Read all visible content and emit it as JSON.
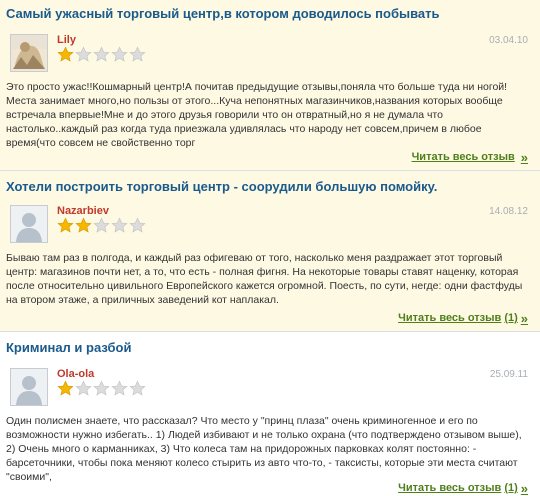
{
  "reviews": [
    {
      "title": "Самый ужасный торговый центр,в котором доводилось побывать",
      "author": "Lily",
      "date": "03.04.10",
      "rating": 1,
      "max_rating": 5,
      "text_lines": [
        "Это просто ужас!!Кошмарный центр!А почитав предыдущие отзывы,поняла что больше туда ни ногой!",
        "Места занимает много,но пользы от этого...Куча непонятных магазинчиков,названия которых вообще",
        "встречала впервые!Мне и до этого друзья говорили что он отвратный,но я не думала что",
        "настолько..каждый раз когда туда приезжала удивлялась что народу нет совсем,причем в любое",
        "время(что совсем не свойственно торг"
      ],
      "read_more": "Читать весь отзыв",
      "read_more_count": ""
    },
    {
      "title": "Хотели построить торговый центр - соорудили большую помойку.",
      "author": "Nazarbiev",
      "date": "14.08.12",
      "rating": 2,
      "max_rating": 5,
      "text_lines": [
        "Бываю там раз в полгода, и каждый раз офигеваю от того, насколько меня раздражает этот торговый",
        "центр: магазинов почти нет, а то, что есть - полная фигня. На некоторые товары ставят наценку, которая",
        "после относительно цивильного Европейского кажется огромной. Поесть, по сути, негде: одни фастфуды",
        "на втором этаже, а приличных заведений кот наплакал."
      ],
      "read_more": "Читать весь отзыв",
      "read_more_count": "(1)"
    },
    {
      "title": "Криминал и разбой",
      "author": "Ola-ola",
      "date": "25.09.11",
      "rating": 1,
      "max_rating": 5,
      "text_lines": [
        "Один полисмен знаете, что рассказал? Что место у \"принц плаза\" очень криминогенное и его по",
        "возможности нужно избегать.. 1) Людей избивают и не только охрана (что подтверждено отзывом выше),",
        "2) Очень много о карманниках, 3) Что колеса там на придорожных парковках колят постоянно: -",
        "барсеточники, чтобы пока меняют колесо стырить из авто что-то, - таксисты, которые эти места считают",
        "\"своими\","
      ],
      "read_more": "Читать весь отзыв",
      "read_more_count": "(1)"
    }
  ],
  "colors": {
    "title": "#1a5a8c",
    "author": "#c0392b",
    "link": "#4f7f1a",
    "star_filled": "#f5b700",
    "star_empty": "#dcdcdc",
    "bg_yellow": "#fdf9e3"
  },
  "icons": {
    "avatar_photo": "user-photo-icon",
    "avatar_default": "default-user-icon",
    "star": "star-icon",
    "arrow": "double-chevron-right-icon"
  }
}
